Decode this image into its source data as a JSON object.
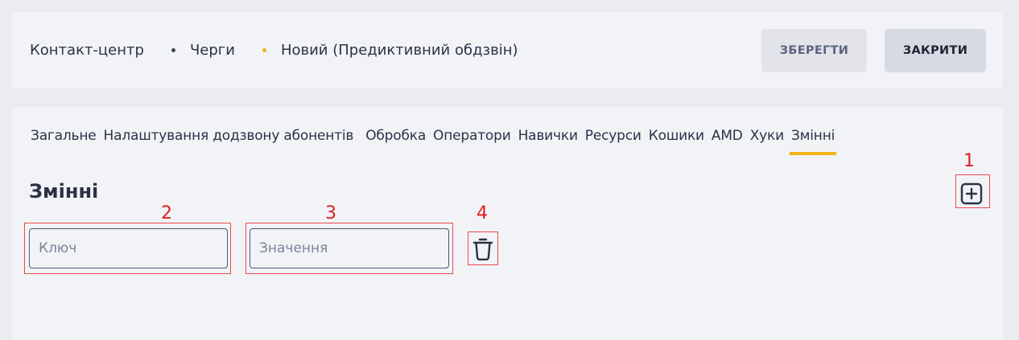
{
  "breadcrumb": {
    "items": [
      "Контакт-центр",
      "Черги",
      "Новий (Предиктивний обдзвін)"
    ]
  },
  "toolbar": {
    "save_label": "ЗБЕРЕГТИ",
    "close_label": "ЗАКРИТИ"
  },
  "tabs": [
    {
      "label": "Загальне"
    },
    {
      "label": "Налаштування додзвону абонентів"
    },
    {
      "label": "Обробка"
    },
    {
      "label": "Оператори"
    },
    {
      "label": "Навички"
    },
    {
      "label": "Ресурси"
    },
    {
      "label": "Кошики"
    },
    {
      "label": "AMD"
    },
    {
      "label": "Хуки"
    },
    {
      "label": "Змінні",
      "active": true
    }
  ],
  "section": {
    "title": "Змінні",
    "key_placeholder": "Ключ",
    "value_placeholder": "Значення",
    "key_value": "",
    "value_value": ""
  },
  "annotations": [
    "1",
    "2",
    "3",
    "4"
  ],
  "colors": {
    "accent": "#f0b417",
    "text": "#2b3245",
    "marker": "#ec4b4b"
  },
  "icons": {
    "add": "plus-square-icon",
    "delete": "trash-icon"
  }
}
